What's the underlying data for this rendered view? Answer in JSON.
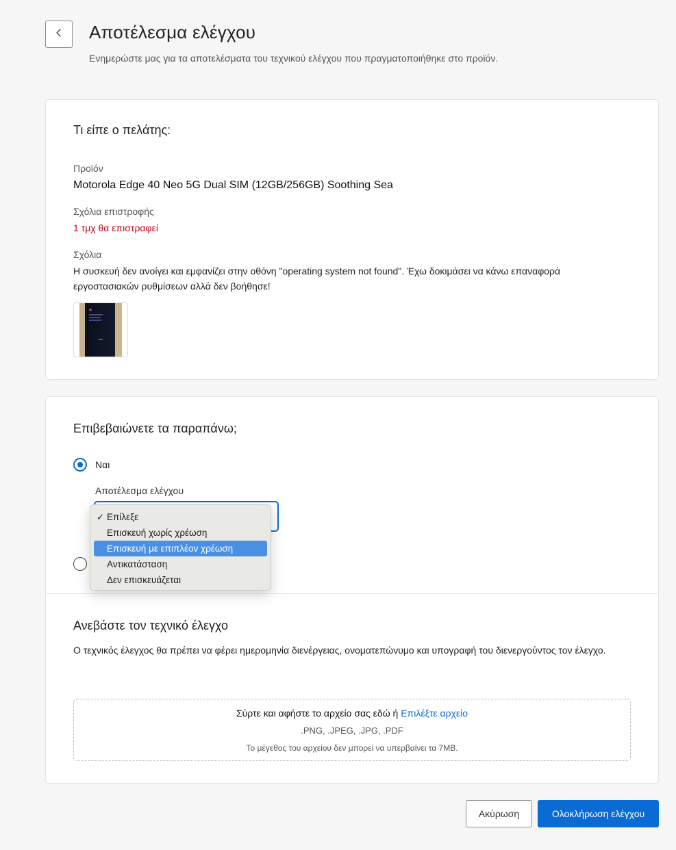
{
  "header": {
    "title": "Αποτέλεσμα ελέγχου",
    "subtitle": "Ενημερώστε μας για τα αποτελέσματα του τεχνικού ελέγχου που πραγματοποιήθηκε στο προϊόν."
  },
  "customer_section": {
    "title": "Τι είπε ο πελάτης:",
    "product_label": "Προϊόν",
    "product_value": "Motorola Edge 40 Neo 5G Dual SIM (12GB/256GB) Soothing Sea",
    "return_comments_label": "Σχόλια επιστροφής",
    "return_comments_value": "1 τμχ θα επιστραφεί",
    "comments_label": "Σχόλια",
    "comments_value": "Η συσκευή δεν ανοίγει και εμφανίζει στην οθόνη \"operating system not found\". Έχω δοκιμάσει να κάνω επαναφορά εργοστασιακών ρυθμίσεων αλλά δεν βοήθησε!"
  },
  "confirm_section": {
    "title": "Επιβεβαιώνετε τα παραπάνω;",
    "yes_label": "Ναι",
    "yes_checked": true,
    "result_label": "Αποτέλεσμα ελέγχου",
    "dropdown_options": [
      "Επίλεξε",
      "Επισκευή χωρίς χρέωση",
      "Επισκευή με επιπλέον χρέωση",
      "Αντικατάσταση",
      "Δεν επισκευάζεται"
    ],
    "dropdown_checkmark": "✓",
    "checked_option": "Επίλεξε",
    "highlighted_option": "Επισκευή με επιπλέον χρέωση"
  },
  "upload_section": {
    "title": "Ανεβάστε τον τεχνικό έλεγχο",
    "description": "Ο τεχνικός έλεγχος θα πρέπει να φέρει ημερομηνία διενέργειας, ονοματεπώνυμο και υπογραφή του διενεργούντος τον έλεγχο.",
    "drop_text": "Σύρτε και αφήστε το αρχείο σας εδώ ή",
    "choose_file": "Επιλέξτε αρχείο",
    "formats": ".PNG, .JPEG, .JPG, .PDF",
    "size_limit": "Το μέγεθος του αρχείου δεν μπορεί να υπερβαίνει τα 7MB."
  },
  "footer": {
    "cancel_label": "Ακύρωση",
    "complete_label": "Ολοκλήρωση ελέγχου"
  },
  "colors": {
    "accent": "#0a6bd4",
    "error": "#d0021b",
    "menu_highlight": "#4a90e2"
  }
}
